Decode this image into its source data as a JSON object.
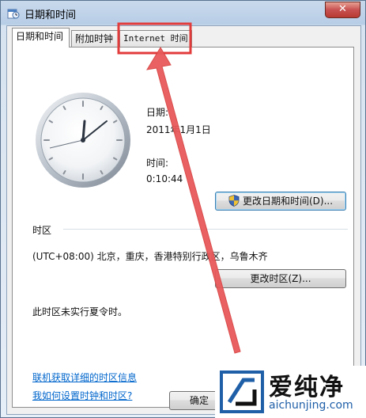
{
  "window": {
    "title": "日期和时间",
    "close_glyph": "✕"
  },
  "tabs": [
    {
      "label": "日期和时间",
      "active": true
    },
    {
      "label": "附加时钟",
      "active": false
    },
    {
      "label": "Internet 时间",
      "active": false,
      "highlighted": true
    }
  ],
  "datetime": {
    "date_label": "日期:",
    "date_value": "2011年1月1日",
    "time_label": "时间:",
    "time_value": "0:10:44",
    "change_button": "更改日期和时间(D)..."
  },
  "timezone": {
    "section_label": "时区",
    "value": "(UTC+08:00) 北京，重庆，香港特别行政区，乌鲁木齐",
    "change_button": "更改时区(Z)...",
    "dst_note": "此时区未实行夏令时。"
  },
  "links": {
    "online_info": "联机获取详细的时区信息",
    "how_to": "我如何设置时钟和时区?"
  },
  "footer": {
    "ok_button": "确定"
  },
  "watermark": {
    "brand": "爱纯净",
    "url": "aichunjing.com"
  },
  "colors": {
    "highlight": "#e23b3b",
    "link": "#0066cc",
    "arrow": "#e8595a"
  },
  "icons": {
    "window": "datetime-clock-icon",
    "shield": "uac-shield-icon"
  }
}
